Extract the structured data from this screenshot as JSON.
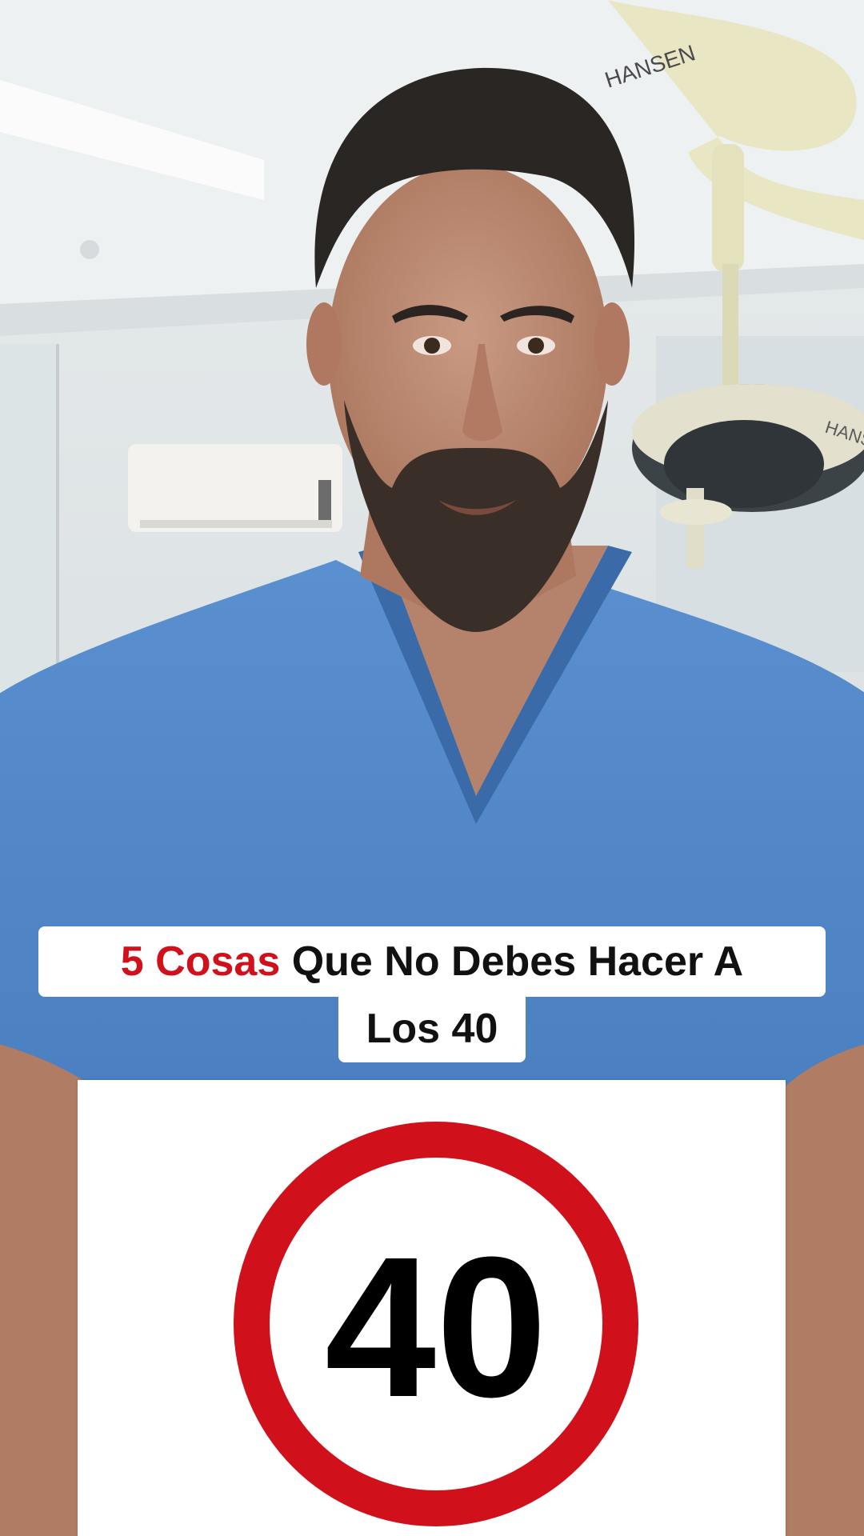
{
  "caption": {
    "highlight": "5 Cosas",
    "line1_rest": " Que No Debes Hacer A",
    "line2": "Los 40"
  },
  "sign": {
    "number": "40"
  },
  "background": {
    "lamp_brand": "HANSEN"
  },
  "colors": {
    "accent_red": "#d0111b",
    "scrubs_blue": "#4d83c5",
    "caption_bg": "#ffffff"
  }
}
